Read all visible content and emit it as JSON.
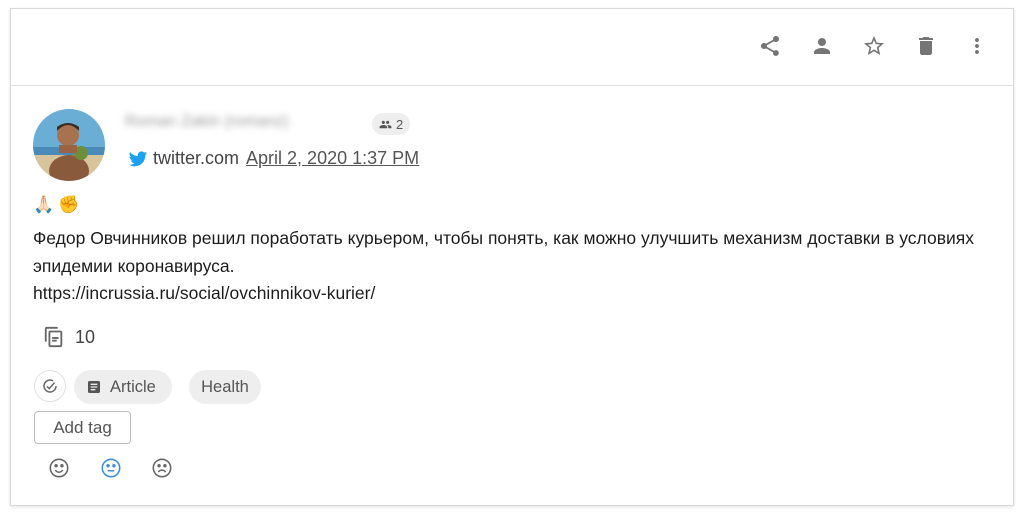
{
  "toolbar": {
    "actions": [
      {
        "icon": "share-icon"
      },
      {
        "icon": "person-icon"
      },
      {
        "icon": "star-icon"
      },
      {
        "icon": "trash-icon"
      },
      {
        "icon": "more-vert-icon"
      }
    ]
  },
  "post": {
    "author_name": "Roman Zakin (romanz)",
    "group_count": "2",
    "source_domain": "twitter.com",
    "date": "April 2, 2020 1:37 PM",
    "emojis": [
      "🙏🏻",
      "✊"
    ],
    "text": "Федор Овчинников решил поработать курьером, чтобы понять, как можно улучшить механизм доставки в условиях эпидемии коронавируса.",
    "link": "https://incrussia.ru/social/ovchinnikov-kurier/",
    "copies_count": "10"
  },
  "tags": {
    "category_label": "Article",
    "topic_label": "Health",
    "add_tag_label": "Add tag"
  },
  "sentiment": {
    "options": [
      "positive",
      "neutral",
      "negative"
    ],
    "selected": "neutral"
  },
  "colors": {
    "twitter_blue": "#1da1f2",
    "selected_sentiment": "#3b8fd9",
    "icon_gray": "#757575"
  }
}
